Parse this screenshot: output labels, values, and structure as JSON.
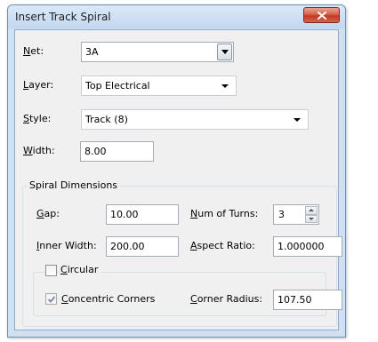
{
  "window": {
    "title": "Insert Track Spiral"
  },
  "net": {
    "label": "Net:",
    "value": "3A"
  },
  "layer": {
    "label": "Layer:",
    "value": "Top Electrical"
  },
  "style": {
    "label": "Style:",
    "value": "Track (8)"
  },
  "width": {
    "label": "Width:",
    "value": "8.00"
  },
  "spiral": {
    "caption": "Spiral Dimensions",
    "gap": {
      "label": "Gap:",
      "value": "10.00"
    },
    "turns": {
      "label": "Num of Turns:",
      "value": "3"
    },
    "inner_width": {
      "label": "Inner Width:",
      "value": "200.00"
    },
    "aspect": {
      "label": "Aspect Ratio:",
      "value": "1.000000"
    },
    "circular": {
      "label": "Circular",
      "checked": false
    },
    "concentric": {
      "label": "Concentric Corners",
      "checked": true
    },
    "corner_radius": {
      "label": "Corner Radius:",
      "value": "107.50"
    }
  }
}
